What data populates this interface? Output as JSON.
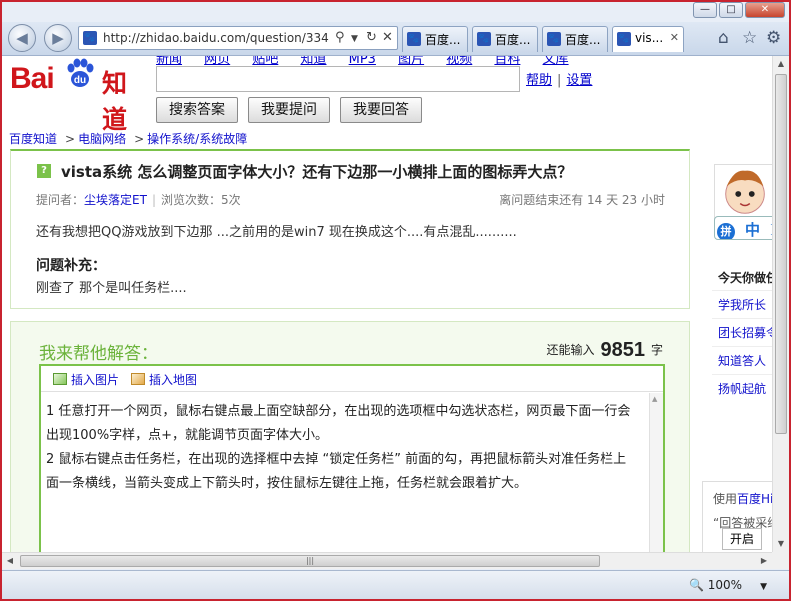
{
  "browser": {
    "address_url": "http://zhidao.baidu.com/question/334",
    "tabs": [
      {
        "label": "百度..."
      },
      {
        "label": "百度..."
      },
      {
        "label": "百度..."
      },
      {
        "label": "vis..."
      }
    ],
    "caption_buttons": {
      "minimize": "—",
      "maximize": "□",
      "close": "✕"
    },
    "zoom": "100%"
  },
  "header": {
    "logo_text": "Bai",
    "logo_du": "du",
    "logo_suffix": "知道",
    "top_nav": [
      "新闻",
      "网页",
      "贴吧",
      "知道",
      "MP3",
      "图片",
      "视频",
      "百科",
      "文库"
    ],
    "links": {
      "help": "帮助",
      "settings": "设置",
      "separator": "|"
    },
    "buttons": {
      "search": "搜索答案",
      "ask": "我要提问",
      "answer": "我要回答"
    }
  },
  "breadcrumb": [
    {
      "label": "百度知道"
    },
    {
      "label": "电脑网络"
    },
    {
      "label": "操作系统/系统故障"
    }
  ],
  "question": {
    "icon": "?",
    "title": "vista系统 怎么调整页面字体大小？还有下边那一小横排上面的图标弄大点？",
    "asker_label": "提问者：",
    "asker": "尘埃落定ET",
    "views_label": "浏览次数：",
    "views": "5次",
    "remaining": "离问题结束还有 14 天 23 小时",
    "body": "还有我想把QQ游戏放到下边那 ...之前用的是win7 现在换成这个....有点混乱..........",
    "supplement_heading": "问题补充：",
    "supplement_body": "刚查了   那个是叫任务栏...."
  },
  "answer": {
    "heading": "我来帮他解答：",
    "remaining_prefix": "还能输入",
    "remaining_count": "9851",
    "remaining_suffix": "字",
    "insert_image": "插入图片",
    "insert_map": "插入地图",
    "text_p1": "1 任意打开一个网页，鼠标右键点最上面空缺部分，在出现的选项框中勾选状态栏，网页最下面一行会出现100%字样，点+，就能调节页面字体大小。",
    "text_p2": "2 鼠标右键点击任务栏，在出现的选择框中去掉 “锁定任务栏” 前面的勾，再把鼠标箭头对准任务栏上面一条横线，当箭头变成上下箭头时，按住鼠标左键往上拖，任务栏就会跟着扩大。"
  },
  "sidebar": {
    "ime_label": "中",
    "ime_moon": "☽",
    "heading": "今天你做任务了吗",
    "items": [
      "学我所长",
      "团长招募令",
      "知道答人",
      "扬帆起航"
    ],
    "promo_prefix": "使用",
    "promo_brand": "百度Hi",
    "promo_line2": "“回答被采纳",
    "open_button": "开启"
  }
}
